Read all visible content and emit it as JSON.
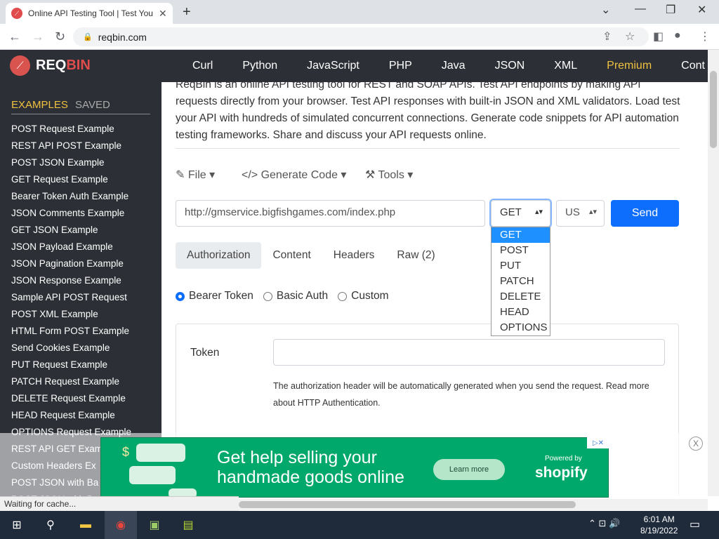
{
  "browser": {
    "tab_title": "Online API Testing Tool | Test You",
    "url": "reqbin.com",
    "new_tab": "+",
    "tab_close": "✕"
  },
  "site": {
    "logo_req": "REQ",
    "logo_bin": "BIN",
    "nav": [
      "Curl",
      "Python",
      "JavaScript",
      "PHP",
      "Java",
      "JSON",
      "XML",
      "Premium",
      "Cont"
    ]
  },
  "sidebar": {
    "tab_examples": "EXAMPLES",
    "tab_saved": "SAVED",
    "items": [
      "POST Request Example",
      "REST API POST Example",
      "POST JSON Example",
      "GET Request Example",
      "Bearer Token Auth Example",
      "JSON Comments Example",
      "GET JSON Example",
      "JSON Payload Example",
      "JSON Pagination Example",
      "JSON Response Example",
      "Sample API POST Request",
      "POST XML Example",
      "HTML Form POST Example",
      "Send Cookies Example",
      "PUT Request Example",
      "PATCH Request Example",
      "DELETE Request Example",
      "HEAD Request Example",
      "OPTIONS Request Example",
      "REST API GET Exam",
      "Custom Headers Ex",
      "POST JSON with Ba",
      "POST JSON with B"
    ]
  },
  "main": {
    "intro": "ReqBin is an online API testing tool for REST and SOAP APIs. Test API endpoints by making API requests directly from your browser. Test API responses with built-in JSON and XML validators. Load test your API with hundreds of simulated concurrent connections. Generate code snippets for API automation testing frameworks. Share and discuss your API requests online.",
    "toolbar": {
      "file": "File",
      "generate": "Generate Code",
      "tools": "Tools"
    },
    "request_url": "http://gmservice.bigfishgames.com/index.php",
    "method": "GET",
    "region": "US",
    "send": "Send",
    "method_options": [
      "GET",
      "POST",
      "PUT",
      "PATCH",
      "DELETE",
      "HEAD",
      "OPTIONS"
    ],
    "tabs": [
      "Authorization",
      "Content",
      "Headers",
      "Raw (2)"
    ],
    "auth_types": [
      "Bearer Token",
      "Basic Auth",
      "Custom"
    ],
    "token_label": "Token",
    "auth_note": "The authorization header will be automatically generated when you send the request. Read more about HTTP Authentication."
  },
  "ad": {
    "headline_1": "Get help selling your",
    "headline_2": "handmade goods online",
    "cta": "Learn more",
    "powered": "Powered by",
    "brand": "shopify",
    "close": "X"
  },
  "status": "Waiting for cache...",
  "taskbar": {
    "time": "6:01 AM",
    "date": "8/19/2022"
  }
}
